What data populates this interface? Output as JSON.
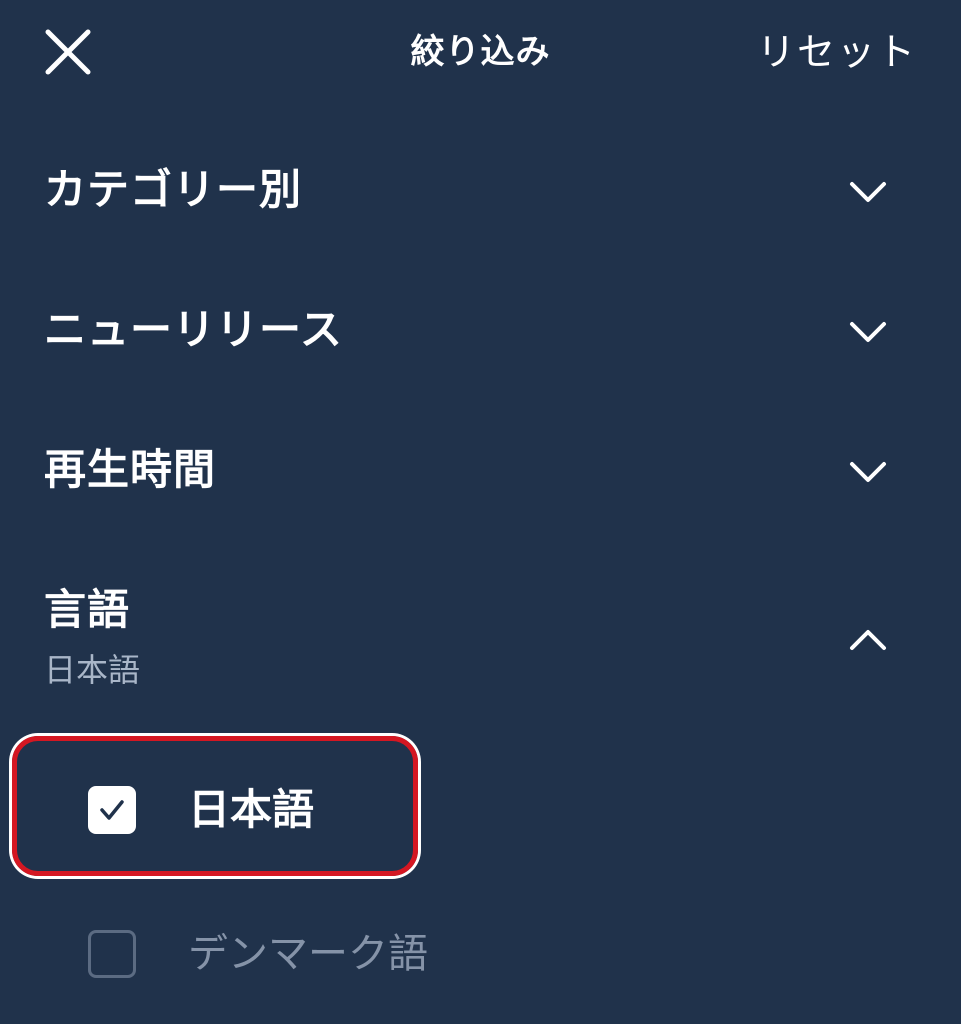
{
  "header": {
    "title": "絞り込み",
    "reset_label": "リセット",
    "close_icon": "close-icon"
  },
  "sections": [
    {
      "label": "カテゴリー別",
      "expanded": false,
      "icon": "chevron-down-icon"
    },
    {
      "label": "ニューリリース",
      "expanded": false,
      "icon": "chevron-down-icon"
    },
    {
      "label": "再生時間",
      "expanded": false,
      "icon": "chevron-down-icon"
    },
    {
      "label": "言語",
      "subtitle": "日本語",
      "expanded": true,
      "icon": "chevron-up-icon"
    }
  ],
  "language_options": [
    {
      "label": "日本語",
      "checked": true
    },
    {
      "label": "デンマーク語",
      "checked": false
    }
  ],
  "colors": {
    "background": "#20324b",
    "text": "#ffffff",
    "muted_text": "#8593a8",
    "highlight_border": "#d41722"
  }
}
